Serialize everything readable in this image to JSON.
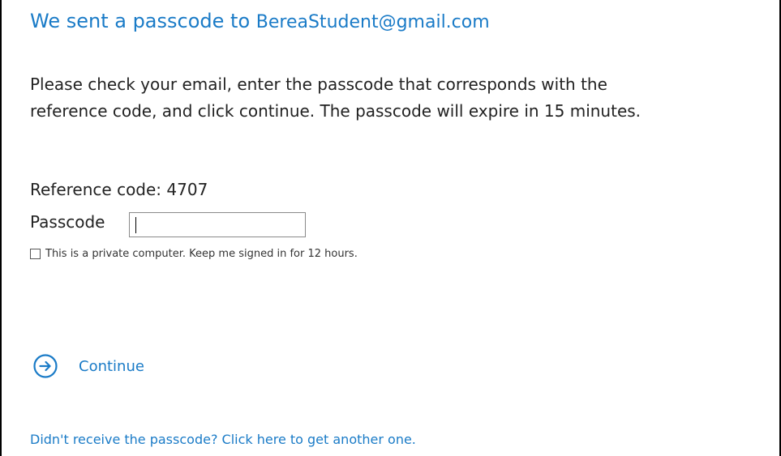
{
  "header": {
    "title_prefix": "We sent a passcode to",
    "email": "BereaStudent@gmail.com"
  },
  "instructions": {
    "line1": "Please check your email, enter the passcode that corresponds with the",
    "line2": "reference code, and click continue. The passcode will expire in 15 minutes."
  },
  "reference": {
    "text": "Reference code: 4707"
  },
  "passcode": {
    "label": "Passcode",
    "value": ""
  },
  "keep_signed_in": {
    "label": "This is a private computer. Keep me signed in for 12 hours.",
    "checked": false
  },
  "continue_button": {
    "label": "Continue",
    "icon": "arrow-circle-icon"
  },
  "resend": {
    "link_text": "Didn't receive the passcode? Click here to get another one."
  },
  "colors": {
    "accent": "#1a7bc7",
    "text": "#222222",
    "border": "#000000"
  }
}
